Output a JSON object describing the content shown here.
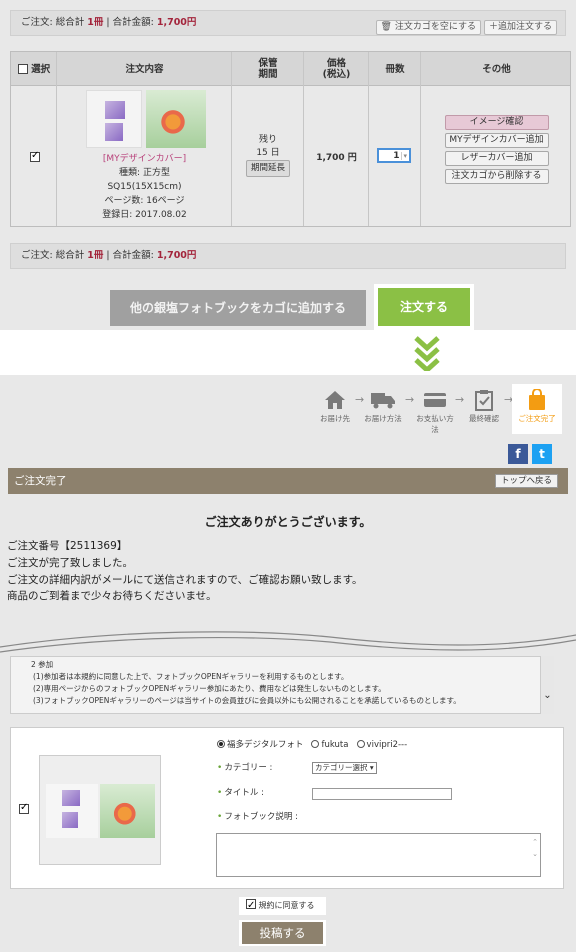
{
  "cart": {
    "summary_label": "ご注文: 総合計",
    "count": "1冊",
    "separator": " | 合計金額: ",
    "total": "1,700円",
    "btn_empty_cart": "注文カゴを空にする",
    "btn_add_order": "＋追加注文する",
    "columns": [
      "選択",
      "注文内容",
      "保管\n期間",
      "価格\n(税込)",
      "冊数",
      "その他"
    ],
    "item": {
      "name": "[MYデザインカバー]",
      "kind": "種類: 正方型",
      "size": "SQ15(15X15cm)",
      "pages": "ページ数: 16ページ",
      "registered": "登録日: 2017.08.02",
      "remaining_line1": "残り",
      "remaining_line2": "15 日",
      "extend_btn": "期間延長",
      "price": "1,700 円",
      "qty": "1",
      "actions": [
        "イメージ確認",
        "MYデザインカバー追加",
        "レザーカバー追加",
        "注文カゴから削除する"
      ]
    },
    "btn_add_other": "他の銀塩フォトブックをカゴに追加する",
    "btn_order": "注文する"
  },
  "steps": [
    {
      "label": "お届け先",
      "icon": "house-icon"
    },
    {
      "label": "お届け方法",
      "icon": "truck-icon"
    },
    {
      "label": "お支払い方法",
      "icon": "card-icon"
    },
    {
      "label": "最終確認",
      "icon": "clipboard-icon"
    },
    {
      "label": "ご注文完了",
      "icon": "shopping-bag-icon"
    }
  ],
  "colors": {
    "accent_green": "#8bc045",
    "brand_brown": "#8d816d",
    "price_red": "#a3243b",
    "active_orange": "#f39c12",
    "facebook": "#3b5998",
    "twitter": "#1da1f2"
  },
  "complete": {
    "title": "ご注文完了",
    "top_button": "トップへ戻る",
    "thanks": "ご注文ありがとうございます。",
    "order_no": "ご注文番号【2511369】",
    "line1": "ご注文が完了致しました。",
    "line2": "ご注文の詳細内訳がメールにて送信されますので、ご確認お願い致します。",
    "line3": "商品のご到着まで少々お待ちくださいませ。"
  },
  "terms": {
    "heading": "2 参加",
    "lines": [
      "(1)参加者は本規約に同意した上で、フォトブックOPENギャラリーを利用するものとします。",
      "(2)専用ページからのフォトブックOPENギャラリー参加にあたり、費用などは発生しないものとします。",
      "(3)フォトブックOPENギャラリーのページは当サイトの会員並びに会員以外にも公開されることを承諾しているものとします。"
    ]
  },
  "form": {
    "radios": [
      "福多デジタルフォト",
      "fukuta",
      "vivipri2---"
    ],
    "category_label": "カテゴリー :",
    "category_select": "カテゴリー選択",
    "title_label": "タイトル :",
    "desc_label": "フォトブック説明 :",
    "agree": "規約に同意する",
    "submit": "投稿する"
  }
}
